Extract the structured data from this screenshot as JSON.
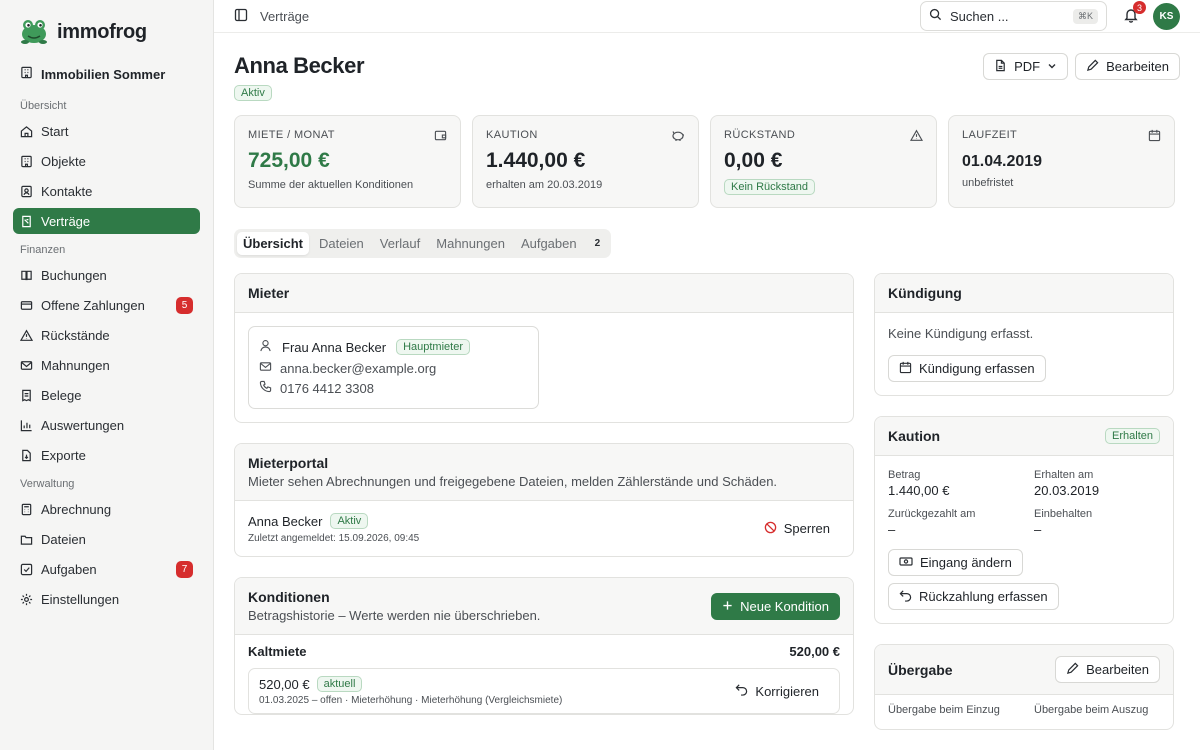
{
  "brand": {
    "name": "immofrog"
  },
  "org": {
    "name": "Immobilien Sommer"
  },
  "sidebar": {
    "sections": [
      {
        "label": "Übersicht",
        "items": [
          {
            "label": "Start",
            "icon": "home-icon"
          },
          {
            "label": "Objekte",
            "icon": "building-icon"
          },
          {
            "label": "Kontakte",
            "icon": "contacts-icon"
          },
          {
            "label": "Verträge",
            "icon": "contract-icon",
            "active": true
          }
        ]
      },
      {
        "label": "Finanzen",
        "items": [
          {
            "label": "Buchungen",
            "icon": "ledger-icon"
          },
          {
            "label": "Offene Zahlungen",
            "icon": "payments-icon",
            "badge": "5"
          },
          {
            "label": "Rückstände",
            "icon": "warning-icon"
          },
          {
            "label": "Mahnungen",
            "icon": "mail-icon"
          },
          {
            "label": "Belege",
            "icon": "receipt-icon"
          },
          {
            "label": "Auswertungen",
            "icon": "chart-icon"
          },
          {
            "label": "Exporte",
            "icon": "export-icon"
          }
        ]
      },
      {
        "label": "Verwaltung",
        "items": [
          {
            "label": "Abrechnung",
            "icon": "calculator-icon"
          },
          {
            "label": "Dateien",
            "icon": "folder-icon"
          },
          {
            "label": "Aufgaben",
            "icon": "checkbox-icon",
            "badge": "7"
          },
          {
            "label": "Einstellungen",
            "icon": "gear-icon"
          }
        ]
      }
    ]
  },
  "topbar": {
    "breadcrumb": "Verträge",
    "search_placeholder": "Suchen ...",
    "search_shortcut": "⌘K",
    "notifications_count": "3",
    "avatar_initials": "KS"
  },
  "header": {
    "name": "Anna Becker",
    "status": "Aktiv",
    "pdf_label": "PDF",
    "edit_label": "Bearbeiten"
  },
  "stats": [
    {
      "label": "Miete / Monat",
      "value": "725,00 €",
      "sub": "Summe der aktuellen Konditionen",
      "icon": "wallet-icon"
    },
    {
      "label": "Kaution",
      "value": "1.440,00 €",
      "sub": "erhalten am 20.03.2019",
      "icon": "piggybank-icon"
    },
    {
      "label": "Rückstand",
      "value": "0,00 €",
      "badge": "Kein Rückstand",
      "icon": "alert-triangle-icon"
    },
    {
      "label": "Laufzeit",
      "value": "01.04.2019",
      "sub": "unbefristet",
      "icon": "calendar-icon"
    }
  ],
  "tabs": [
    {
      "label": "Übersicht",
      "active": true
    },
    {
      "label": "Dateien"
    },
    {
      "label": "Verlauf"
    },
    {
      "label": "Mahnungen"
    },
    {
      "label": "Aufgaben",
      "count": "2"
    }
  ],
  "mieter": {
    "title": "Mieter",
    "name": "Frau Anna Becker",
    "role": "Hauptmieter",
    "email": "anna.becker@example.org",
    "phone": "0176 4412 3308"
  },
  "portal": {
    "title": "Mieterportal",
    "subtitle": "Mieter sehen Abrechnungen und freigegebene Dateien, melden Zählerstände und Schäden.",
    "user": "Anna Becker",
    "status": "Aktiv",
    "last_login": "Zuletzt angemeldet: 15.09.2026, 09:45",
    "block_label": "Sperren"
  },
  "konditionen": {
    "title": "Konditionen",
    "subtitle": "Betragshistorie – Werte werden nie überschrieben.",
    "add_label": "Neue Kondition",
    "row_label": "Kaltmiete",
    "row_amount": "520,00 €",
    "entry_amount": "520,00 €",
    "entry_badge": "aktuell",
    "entry_meta": "01.03.2025 – offen · Mieterhöhung · Mieterhöhung (Vergleichsmiete)",
    "correct_label": "Korrigieren"
  },
  "kuendigung": {
    "title": "Kündigung",
    "text": "Keine Kündigung erfasst.",
    "action_label": "Kündigung erfassen"
  },
  "kaution": {
    "title": "Kaution",
    "status": "Erhalten",
    "fields": [
      {
        "label": "Betrag",
        "value": "1.440,00 €"
      },
      {
        "label": "Erhalten am",
        "value": "20.03.2019"
      },
      {
        "label": "Zurückgezahlt am",
        "value": "–"
      },
      {
        "label": "Einbehalten",
        "value": "–"
      }
    ],
    "change_label": "Eingang ändern",
    "refund_label": "Rückzahlung erfassen"
  },
  "uebergabe": {
    "title": "Übergabe",
    "edit_label": "Bearbeiten",
    "einzug_label": "Übergabe beim Einzug",
    "auszug_label": "Übergabe beim Auszug"
  },
  "colors": {
    "accent": "#2f7a47",
    "danger": "#d62d2d",
    "surface": "#f7f7f6"
  }
}
